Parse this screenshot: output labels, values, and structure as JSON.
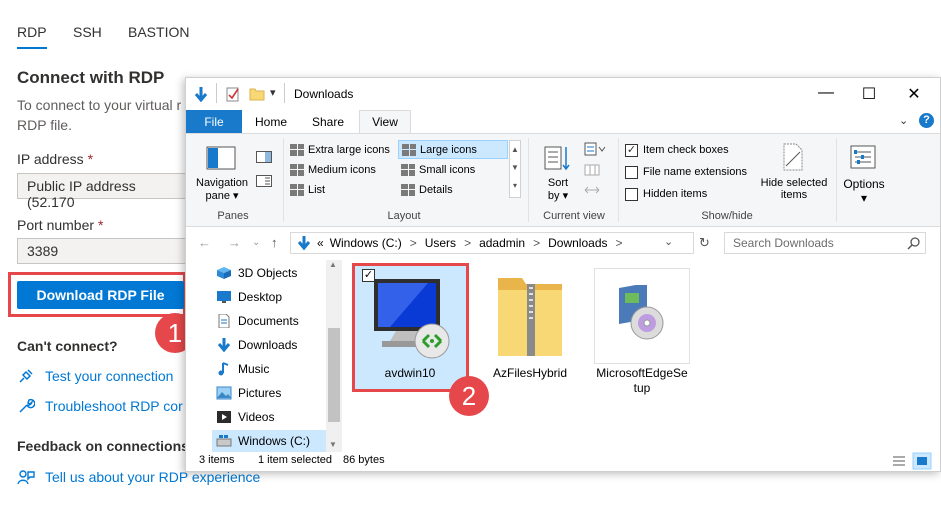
{
  "rdp_panel": {
    "tabs": [
      {
        "label": "RDP",
        "active": true
      },
      {
        "label": "SSH",
        "active": false
      },
      {
        "label": "BASTION",
        "active": false
      }
    ],
    "heading": "Connect with RDP",
    "description_line1": "To connect to your virtual r",
    "description_line2": "RDP file.",
    "ip_label": "IP address",
    "ip_value": "Public IP address (52.170",
    "port_label": "Port number",
    "port_value": "3389",
    "required_mark": "*",
    "download_button": "Download RDP File",
    "callout_1": "1",
    "cant_connect": "Can't connect?",
    "test_link": "Test your connection",
    "troubleshoot_link": "Troubleshoot RDP cor",
    "feedback_heading": "Feedback on connections",
    "feedback_link": "Tell us about your RDP experience",
    "accent_color": "#0078d4",
    "highlight_color": "#e5474a"
  },
  "explorer": {
    "title": "Downloads",
    "window_controls": {
      "minimize": "—",
      "maximize": "☐",
      "close": "✕"
    },
    "ribbon_tabs": [
      "File",
      "Home",
      "Share",
      "View"
    ],
    "active_tab": "View",
    "panes": {
      "nav_pane_line1": "Navigation",
      "nav_pane_line2": "pane ▾",
      "group_label": "Panes"
    },
    "layout": {
      "items": [
        "Extra large icons",
        "Large icons",
        "Medium icons",
        "Small icons",
        "List",
        "Details"
      ],
      "selected": "Large icons",
      "group_label": "Layout"
    },
    "current_view": {
      "sort_line1": "Sort",
      "sort_line2": "by ▾",
      "group_label": "Current view"
    },
    "show_hide": {
      "item_check_boxes": "Item check boxes",
      "item_check_boxes_checked": true,
      "file_name_extensions": "File name extensions",
      "file_name_extensions_checked": false,
      "hidden_items": "Hidden items",
      "hidden_items_checked": false,
      "hide_selected_line1": "Hide selected",
      "hide_selected_line2": "items",
      "group_label": "Show/hide"
    },
    "options": {
      "label": "Options",
      "arrow": "▾"
    },
    "address": {
      "prefix": "«",
      "crumbs": [
        "Windows (C:)",
        "Users",
        "adadmin",
        "Downloads"
      ],
      "separator": ">"
    },
    "search_placeholder": "Search Downloads",
    "nav_items": [
      "3D Objects",
      "Desktop",
      "Documents",
      "Downloads",
      "Music",
      "Pictures",
      "Videos",
      "Windows (C:)"
    ],
    "nav_selected": "Windows (C:)",
    "files": [
      {
        "name": "avdwin10",
        "selected": true
      },
      {
        "name": "AzFilesHybrid",
        "selected": false
      },
      {
        "name_line1": "MicrosoftEdgeSe",
        "name_line2": "tup",
        "selected": false
      }
    ],
    "callout_2": "2",
    "status": {
      "count": "3 items",
      "selected": "1 item selected",
      "size": "86 bytes"
    }
  }
}
